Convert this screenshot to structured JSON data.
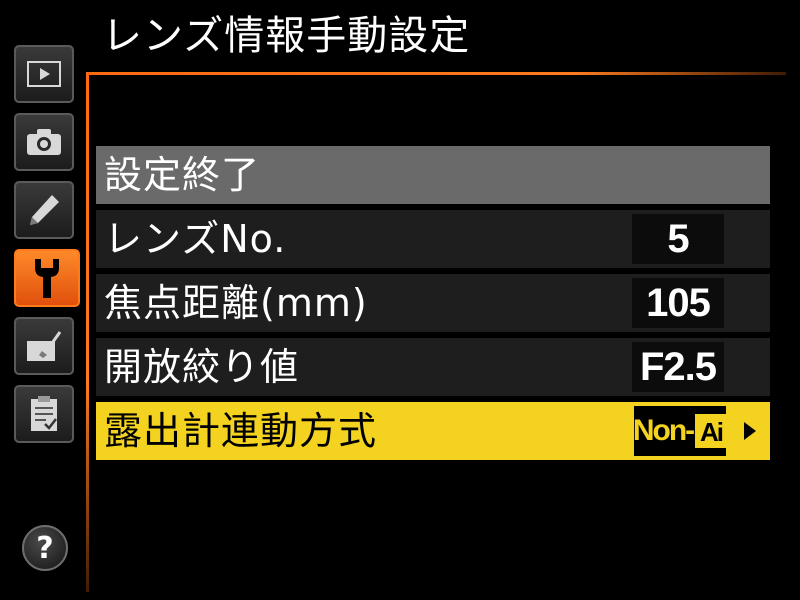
{
  "screen": {
    "title": "レンズ情報手動設定"
  },
  "sidebar": {
    "tabs": [
      {
        "id": "playback",
        "icon": "playback-icon"
      },
      {
        "id": "shooting",
        "icon": "camera-icon"
      },
      {
        "id": "retouch",
        "icon": "pencil-icon"
      },
      {
        "id": "setup",
        "icon": "wrench-icon",
        "active": true
      },
      {
        "id": "custom",
        "icon": "brush-icon"
      },
      {
        "id": "mymenu",
        "icon": "clipboard-icon"
      }
    ],
    "help_label": "?"
  },
  "menu": {
    "header": {
      "label": "設定終了"
    },
    "items": [
      {
        "label": "レンズNo.",
        "value": "5"
      },
      {
        "label": "焦点距離(mm)",
        "value": "105"
      },
      {
        "label": "開放絞り値",
        "value": "F2.5"
      },
      {
        "label": "露出計連動方式",
        "value": "Non-",
        "badge": "Ai",
        "selected": true
      }
    ]
  },
  "colors": {
    "accent_orange": "#ff6a10",
    "selected_yellow": "#f3d31f",
    "header_gray": "#6a6a6a",
    "row_dark": "#1e1e1e"
  }
}
